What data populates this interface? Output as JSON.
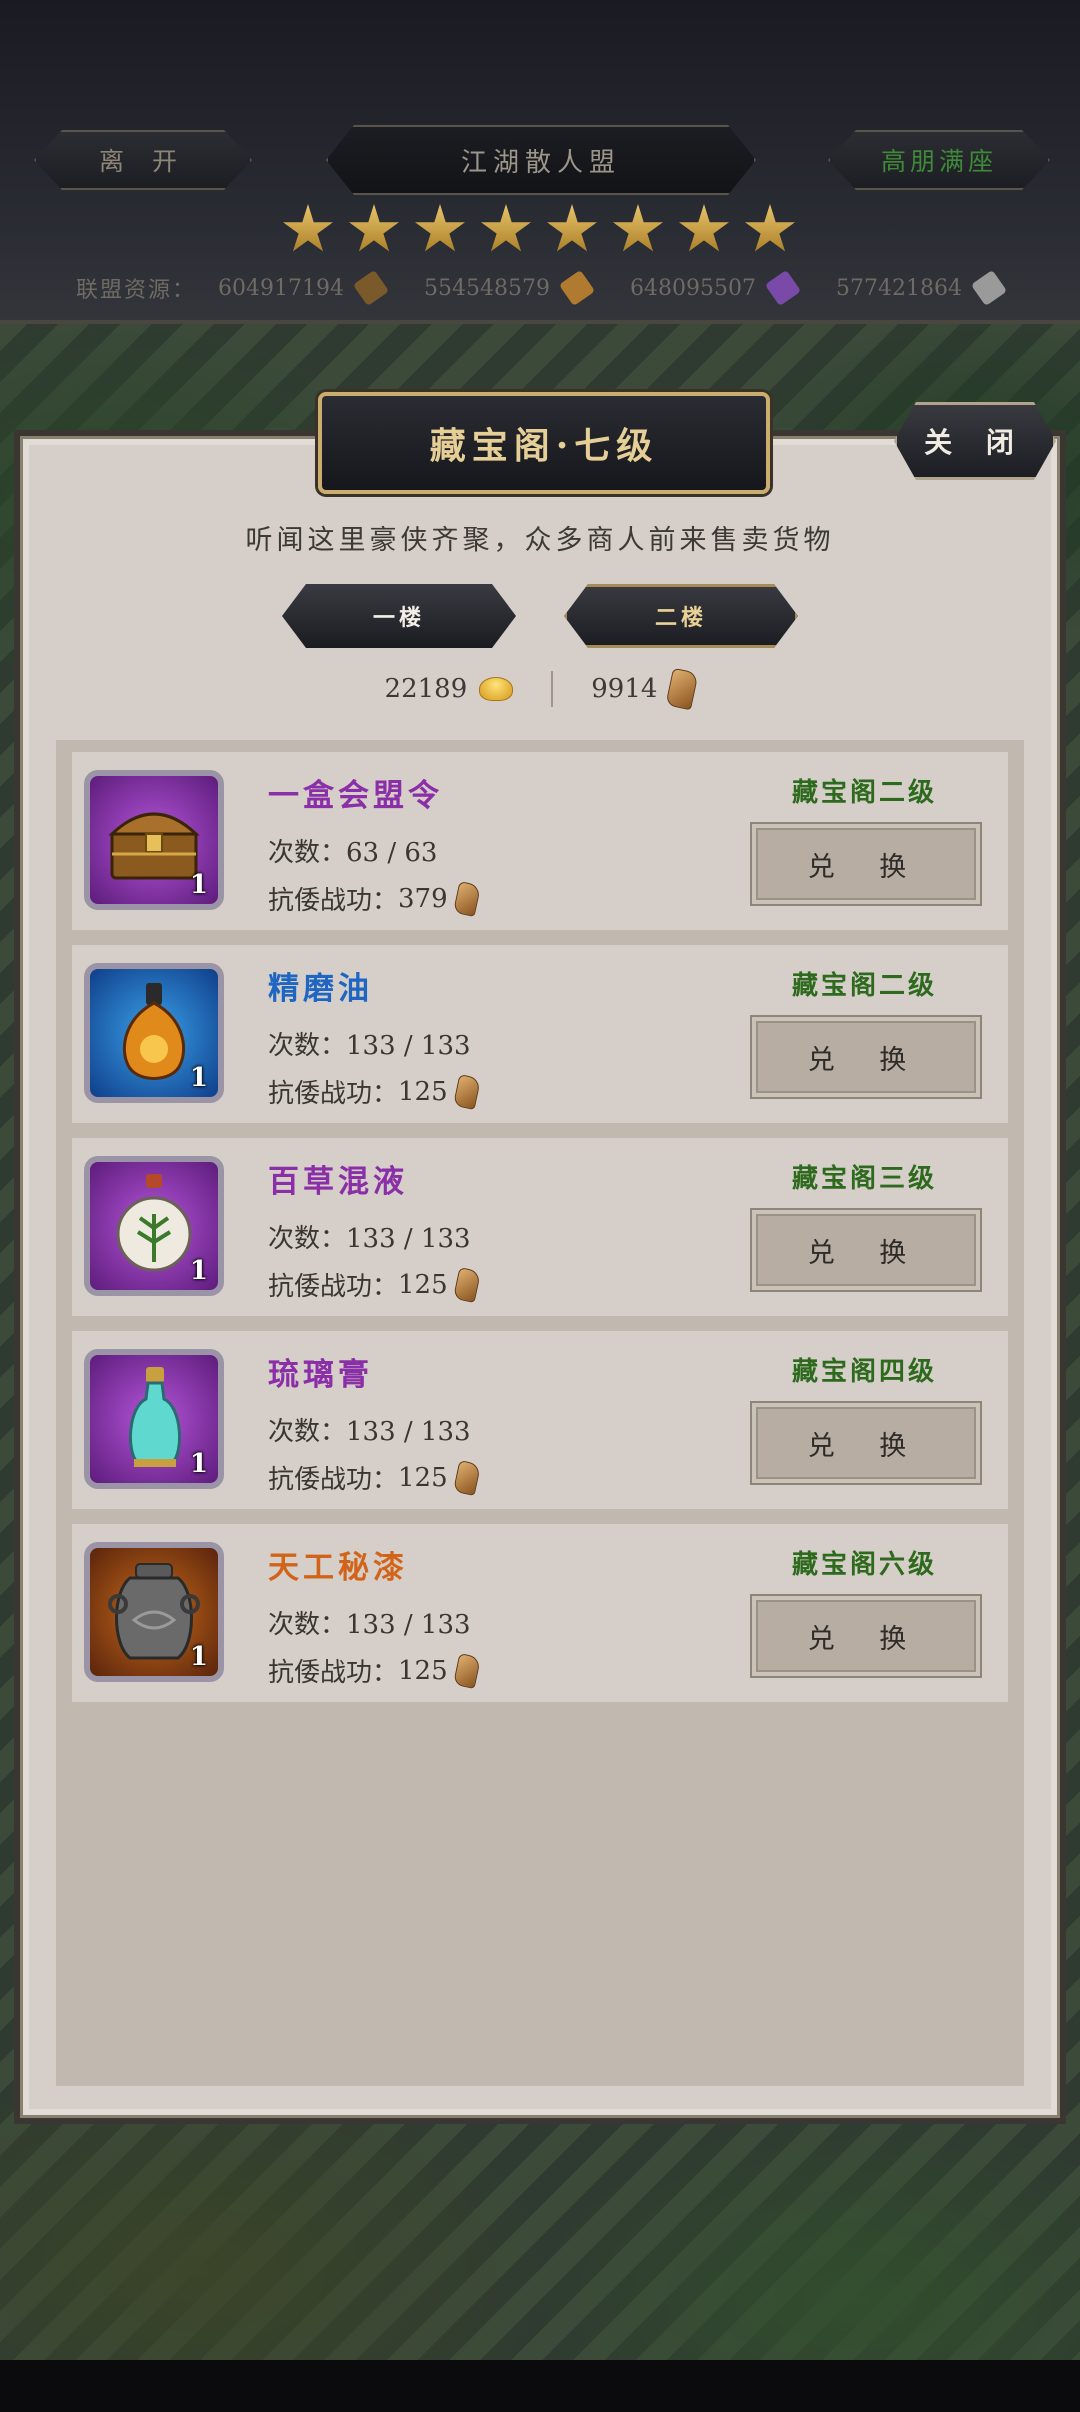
{
  "header": {
    "leave_label": "离 开",
    "alliance_name": "江湖散人盟",
    "status_label": "高朋满座",
    "stars": 8,
    "resources_label": "联盟资源：",
    "resources": [
      {
        "value": "604917194",
        "icon": "quill-icon",
        "color": "#7a5a2a"
      },
      {
        "value": "554548579",
        "icon": "wood-icon",
        "color": "#b07a30"
      },
      {
        "value": "648095507",
        "icon": "crystal-icon",
        "color": "#7a4aa8"
      },
      {
        "value": "577421864",
        "icon": "stone-icon",
        "color": "#9a9a9a"
      }
    ]
  },
  "panel": {
    "title": "藏宝阁·七级",
    "close_label": "关 闭",
    "subtitle": "听闻这里豪侠齐聚，众多商人前来售卖货物",
    "tabs": [
      {
        "label": "一楼"
      },
      {
        "label": "二楼"
      }
    ],
    "selected_tab": "二楼",
    "currency": {
      "gold": "22189",
      "merit": "9914"
    }
  },
  "items": [
    {
      "name": "一盒会盟令",
      "name_color": "#8a2fa8",
      "frame": "purple",
      "qty": "1",
      "count": "次数：63 / 63",
      "cost_label": "抗倭战功：",
      "cost": "379",
      "requirement": "藏宝阁二级",
      "button": "兑 换"
    },
    {
      "name": "精磨油",
      "name_color": "#1f66c2",
      "frame": "blue",
      "qty": "1",
      "count": "次数：133 / 133",
      "cost_label": "抗倭战功：",
      "cost": "125",
      "requirement": "藏宝阁二级",
      "button": "兑 换"
    },
    {
      "name": "百草混液",
      "name_color": "#8a2fa8",
      "frame": "purple",
      "qty": "1",
      "count": "次数：133 / 133",
      "cost_label": "抗倭战功：",
      "cost": "125",
      "requirement": "藏宝阁三级",
      "button": "兑 换"
    },
    {
      "name": "琉璃膏",
      "name_color": "#8a2fa8",
      "frame": "purple",
      "qty": "1",
      "count": "次数：133 / 133",
      "cost_label": "抗倭战功：",
      "cost": "125",
      "requirement": "藏宝阁四级",
      "button": "兑 换"
    },
    {
      "name": "天工秘漆",
      "name_color": "#d2641a",
      "frame": "orange",
      "qty": "1",
      "count": "次数：133 / 133",
      "cost_label": "抗倭战功：",
      "cost": "125",
      "requirement": "藏宝阁六级",
      "button": "兑 换"
    }
  ]
}
